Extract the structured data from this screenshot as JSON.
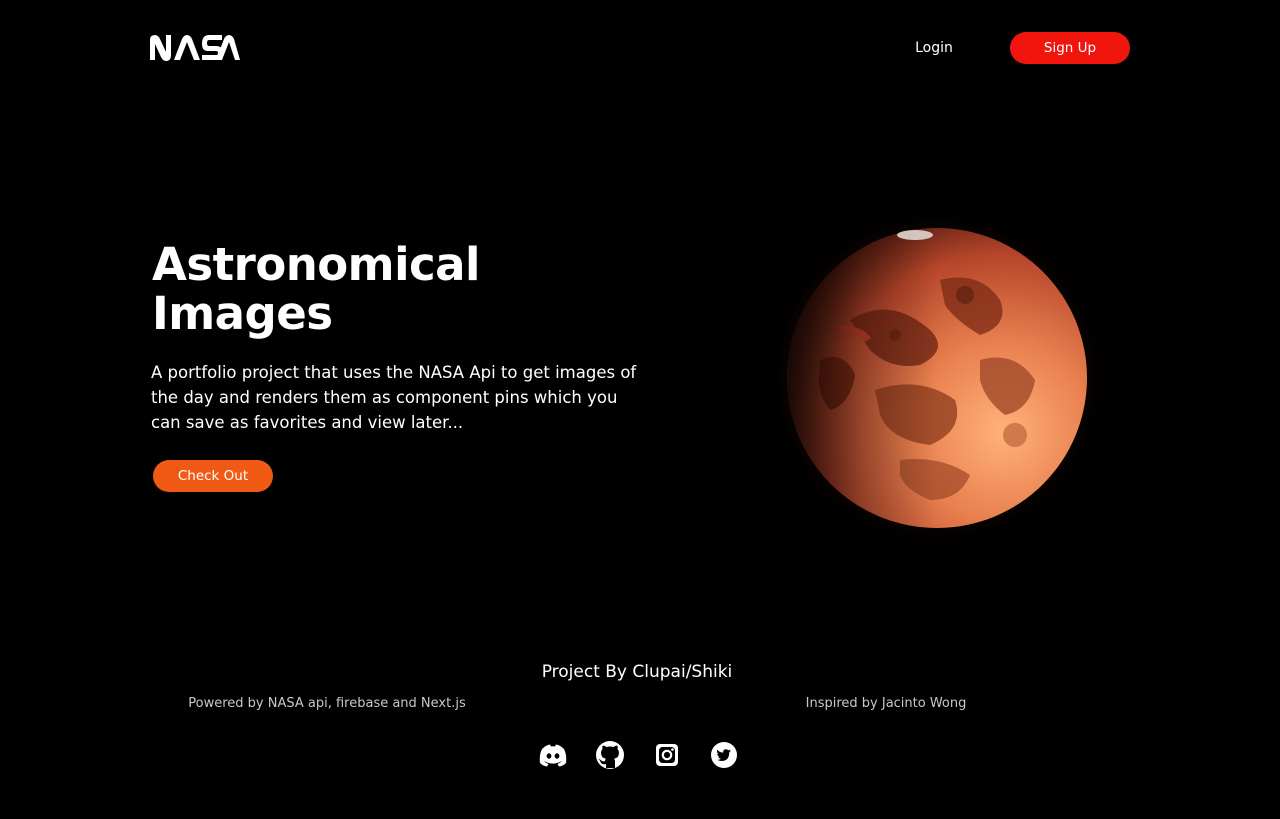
{
  "header": {
    "logo_text": "NASA",
    "login_label": "Login",
    "signup_label": "Sign Up"
  },
  "hero": {
    "title": "Astronomical Images",
    "description": "A portfolio project that uses the NASA Api to get images of the day and renders them as component pins which you can save as favorites and view later...",
    "cta_label": "Check Out",
    "image": "mars-planet"
  },
  "footer": {
    "credit": "Project By Clupai/Shiki",
    "powered_by": "Powered by NASA api, firebase and Next.js",
    "inspired_by": "Inspired by Jacinto Wong",
    "social_icons": [
      "discord-icon",
      "github-icon",
      "instagram-icon",
      "twitter-icon"
    ]
  },
  "colors": {
    "background": "#000000",
    "signup_button": "#f0150d",
    "cta_button": "#f05a14",
    "text": "#ffffff"
  }
}
